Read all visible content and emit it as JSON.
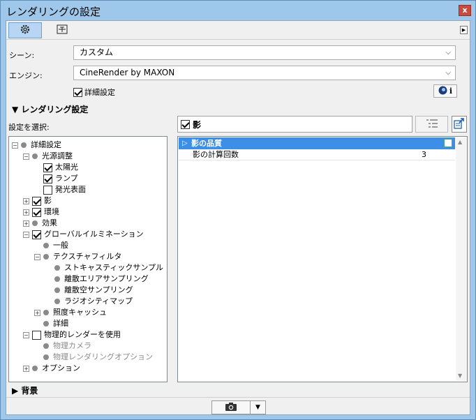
{
  "window": {
    "title": "レンダリングの設定",
    "close_label": "x"
  },
  "scene": {
    "label": "シーン:",
    "value": "カスタム"
  },
  "engine": {
    "label": "エンジン:",
    "value": "CineRender by MAXON"
  },
  "detail_checkbox": {
    "label": "詳細設定",
    "checked": true
  },
  "info_button": {
    "label": "i"
  },
  "rendering_section": {
    "label": "レンダリング設定"
  },
  "select_label": "設定を選択:",
  "tree": [
    {
      "label": "詳細設定",
      "kind": "dot",
      "expander": "−"
    },
    {
      "label": "光源調整",
      "kind": "dot",
      "expander": "−"
    },
    {
      "label": "太陽光",
      "kind": "check",
      "checked": true
    },
    {
      "label": "ランプ",
      "kind": "check",
      "checked": true
    },
    {
      "label": "発光表面",
      "kind": "check",
      "checked": false
    },
    {
      "label": "影",
      "kind": "check",
      "checked": true,
      "expander": "+"
    },
    {
      "label": "環境",
      "kind": "check",
      "checked": true,
      "expander": "+"
    },
    {
      "label": "効果",
      "kind": "dot",
      "expander": "+"
    },
    {
      "label": "グローバルイルミネーション",
      "kind": "check",
      "checked": true,
      "expander": "−"
    },
    {
      "label": "一般",
      "kind": "dot"
    },
    {
      "label": "テクスチャフィルタ",
      "kind": "dot",
      "expander": "−"
    },
    {
      "label": "ストキャスティックサンプル",
      "kind": "dot"
    },
    {
      "label": "離散エリアサンプリング",
      "kind": "dot"
    },
    {
      "label": "離散空サンプリング",
      "kind": "dot"
    },
    {
      "label": "ラジオシティマップ",
      "kind": "dot"
    },
    {
      "label": "照度キャッシュ",
      "kind": "dot",
      "expander": "+"
    },
    {
      "label": "詳細",
      "kind": "dot"
    },
    {
      "label": "物理的レンダーを使用",
      "kind": "check",
      "checked": false,
      "expander": "−"
    },
    {
      "label": "物理カメラ",
      "kind": "dot",
      "disabled": true
    },
    {
      "label": "物理レンダリングオプション",
      "kind": "dot",
      "disabled": true
    },
    {
      "label": "オプション",
      "kind": "dot",
      "expander": "+"
    }
  ],
  "right_panel": {
    "header_label": "影",
    "header_checked": true,
    "group_label": "影の品質",
    "rows": [
      {
        "name": "影の計算回数",
        "value": "3"
      }
    ]
  },
  "background_section": {
    "label": "背景"
  },
  "colors": {
    "accent": "#3d8ee6",
    "window_frame": "#9fc7ea",
    "close": "#c94a3f"
  }
}
